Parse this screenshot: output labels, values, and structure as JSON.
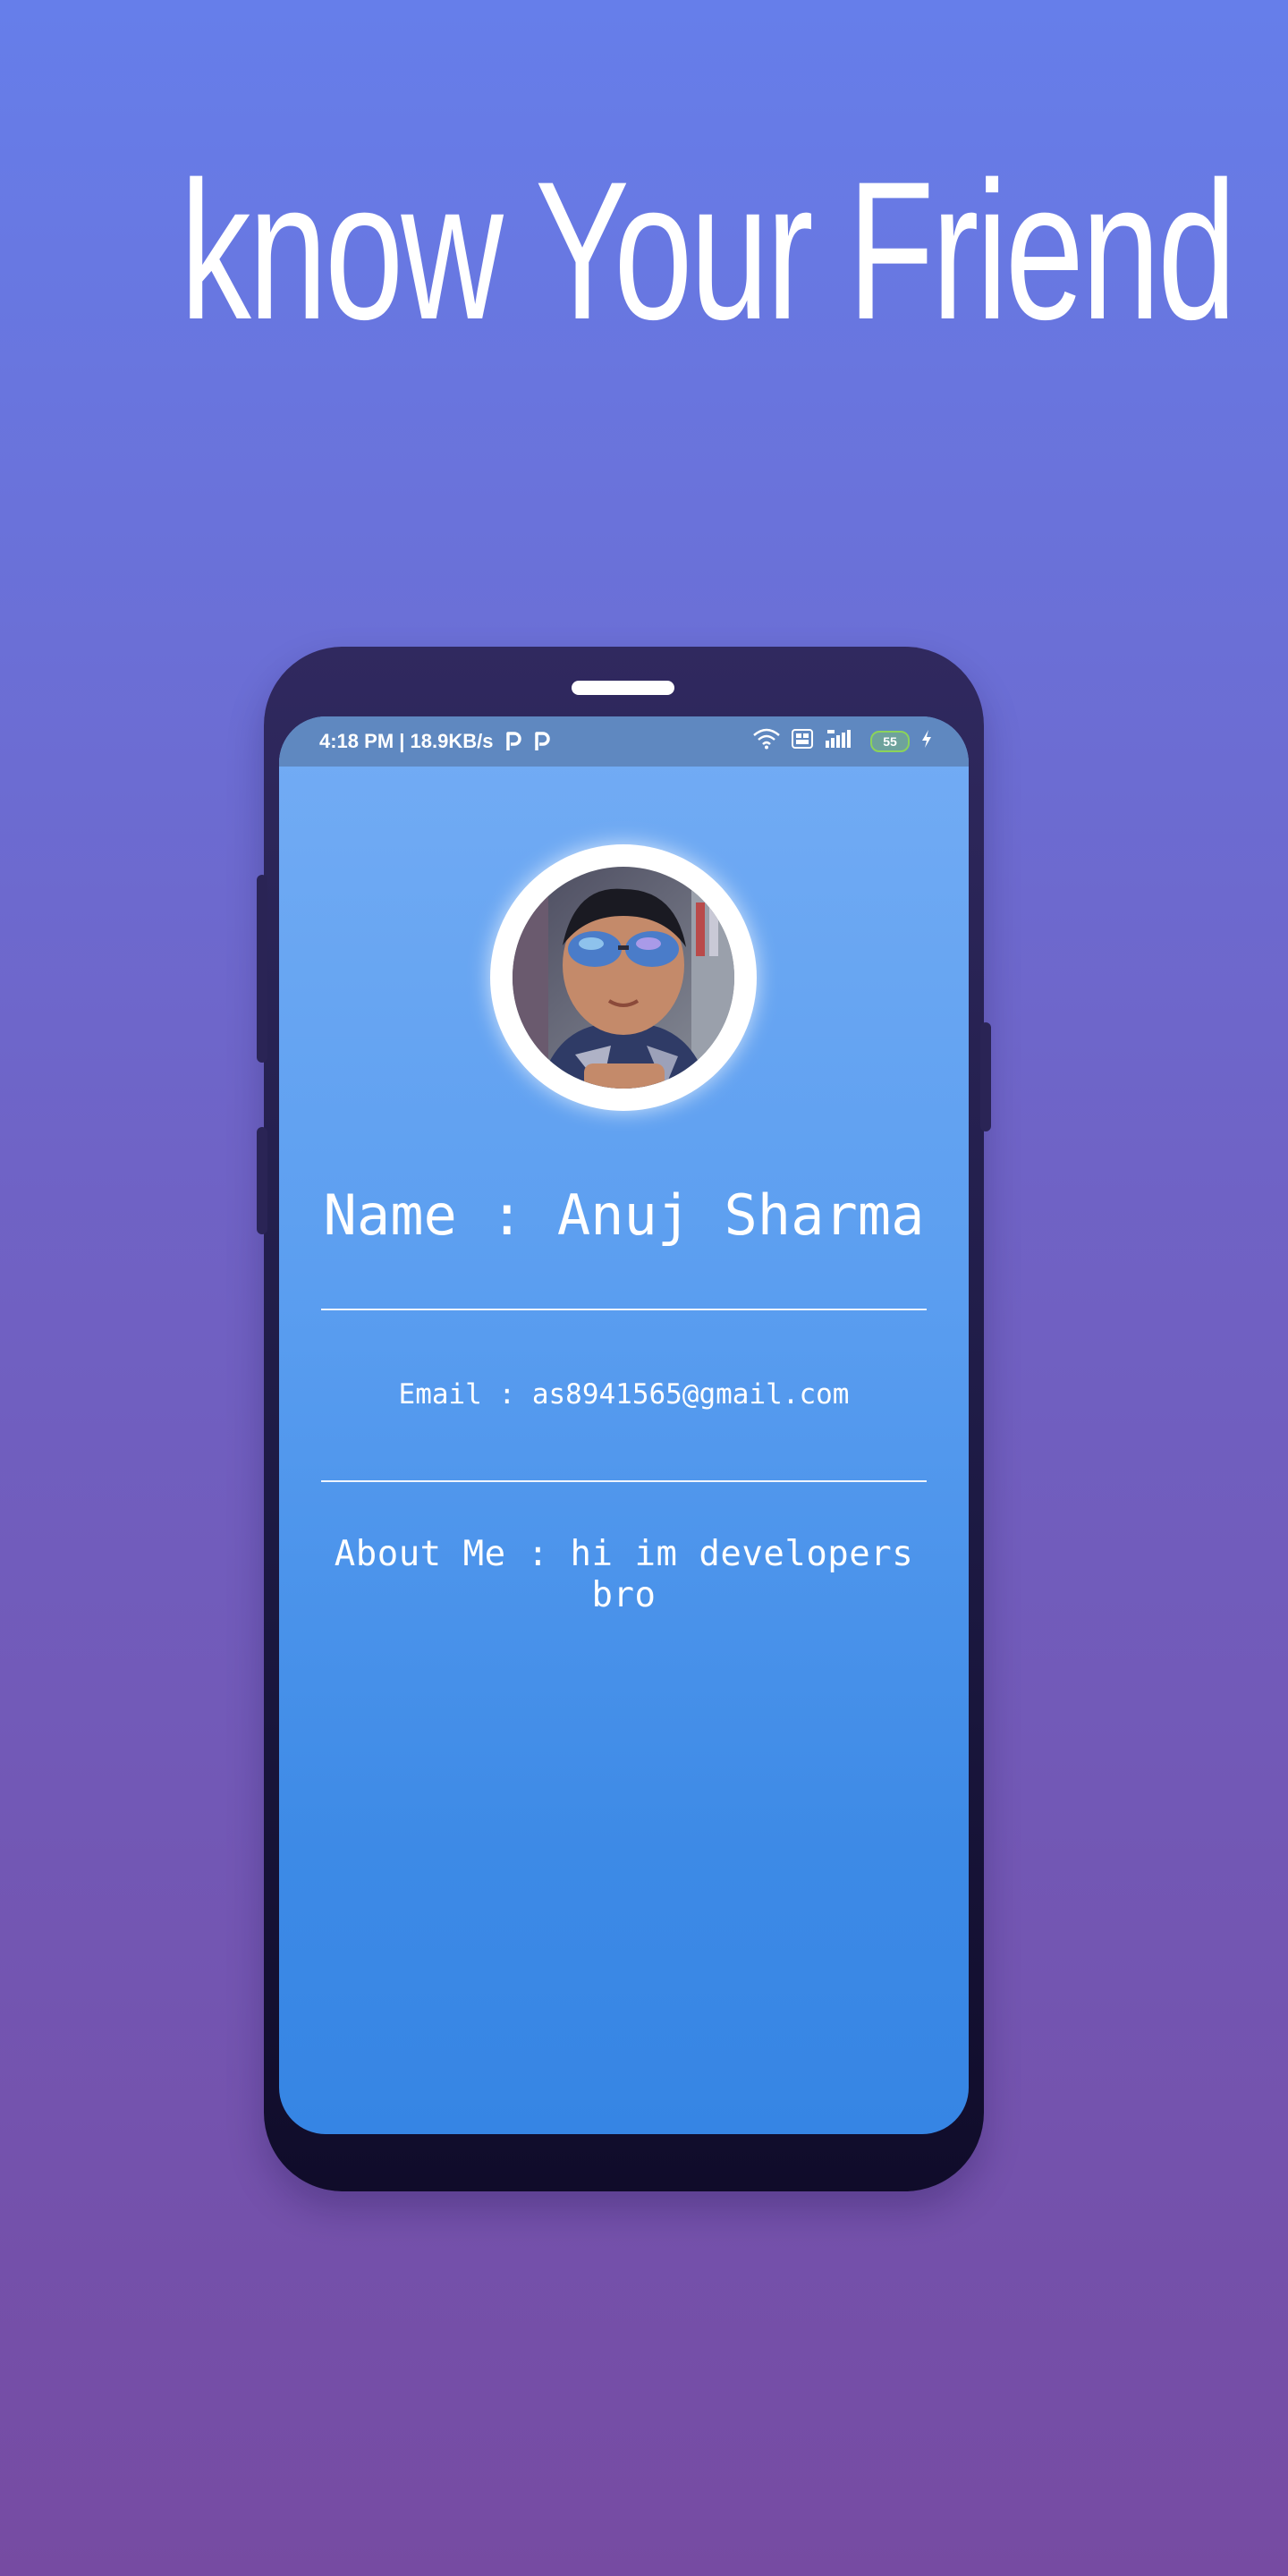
{
  "headline": "know Your Friend",
  "status_bar": {
    "left_text": "4:18 PM | 18.9KB/s",
    "battery": "55",
    "icons": [
      "p-icon",
      "p-icon",
      "wifi-icon",
      "volte-icon",
      "signal-4g-icon",
      "battery-icon",
      "charging-icon"
    ]
  },
  "profile": {
    "avatar": "profile-photo",
    "name_line": "Name : Anuj Sharma",
    "email_line": "Email : as8941565@gmail.com",
    "about_line": "About Me : hi im developers bro"
  },
  "colors": {
    "background_top": "#667eea",
    "background_bottom": "#764ba2",
    "phone_body": "#2a245a",
    "screen_top": "#73acf4",
    "screen_bottom": "#3685e4",
    "status_bar": "#5f88c0",
    "battery_accent": "#8bd35a"
  }
}
